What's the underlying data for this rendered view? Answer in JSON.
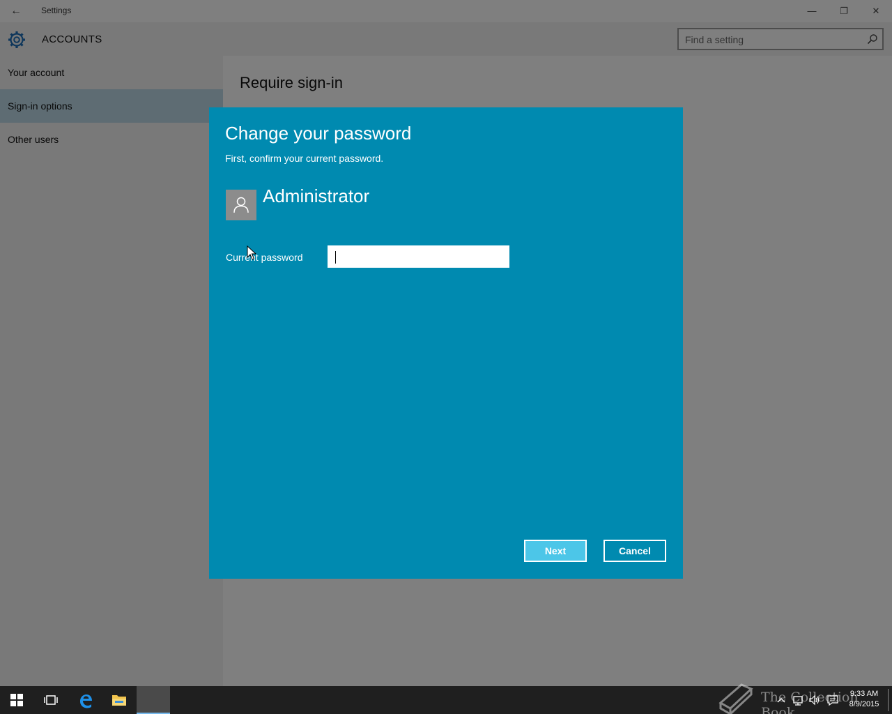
{
  "window": {
    "title": "Settings",
    "controls": {
      "minimize": "—",
      "maximize": "❐",
      "close": "✕"
    }
  },
  "header": {
    "section": "ACCOUNTS",
    "search_placeholder": "Find a setting"
  },
  "sidebar": {
    "items": [
      {
        "label": "Your account"
      },
      {
        "label": "Sign-in options",
        "selected": true
      },
      {
        "label": "Other users"
      }
    ]
  },
  "content": {
    "page_title": "Require sign-in"
  },
  "dialog": {
    "title": "Change your password",
    "subtitle": "First, confirm your current password.",
    "username": "Administrator",
    "password_label": "Current password",
    "password_value": "",
    "next_label": "Next",
    "cancel_label": "Cancel",
    "background_color": "#008ab0",
    "next_button_color": "#4cc6e8"
  },
  "taskbar": {
    "icons": [
      "start-icon",
      "task-view-icon",
      "edge-icon",
      "file-explorer-icon",
      "settings-app-icon"
    ],
    "watermark": "The Collection Book",
    "clock_time": "9:33 AM",
    "clock_date": "8/9/2015"
  }
}
